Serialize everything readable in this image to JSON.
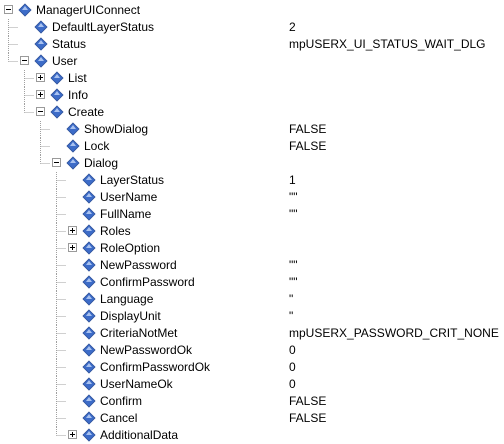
{
  "colors": {
    "diamond_fill": "#3d6cc8",
    "diamond_light": "#a9c2f0",
    "line": "#a0a0a0"
  },
  "icons": {
    "node": "diamond-icon",
    "expand": "plus-box-icon",
    "collapse": "minus-box-icon"
  },
  "tree": [
    {
      "name": "ManagerUIConnect",
      "value": "",
      "depth": 0,
      "state": "expanded"
    },
    {
      "name": "DefaultLayerStatus",
      "value": "2",
      "depth": 1,
      "state": "leaf"
    },
    {
      "name": "Status",
      "value": "mpUSERX_UI_STATUS_WAIT_DLG",
      "depth": 1,
      "state": "leaf"
    },
    {
      "name": "User",
      "value": "",
      "depth": 1,
      "state": "expanded"
    },
    {
      "name": "List",
      "value": "",
      "depth": 2,
      "state": "collapsed"
    },
    {
      "name": "Info",
      "value": "",
      "depth": 2,
      "state": "collapsed"
    },
    {
      "name": "Create",
      "value": "",
      "depth": 2,
      "state": "expanded"
    },
    {
      "name": "ShowDialog",
      "value": "FALSE",
      "depth": 3,
      "state": "leaf"
    },
    {
      "name": "Lock",
      "value": "FALSE",
      "depth": 3,
      "state": "leaf"
    },
    {
      "name": "Dialog",
      "value": "",
      "depth": 3,
      "state": "expanded"
    },
    {
      "name": "LayerStatus",
      "value": "1",
      "depth": 4,
      "state": "leaf"
    },
    {
      "name": "UserName",
      "value": "\"\"",
      "depth": 4,
      "state": "leaf"
    },
    {
      "name": "FullName",
      "value": "\"\"",
      "depth": 4,
      "state": "leaf"
    },
    {
      "name": "Roles",
      "value": "",
      "depth": 4,
      "state": "collapsed"
    },
    {
      "name": "RoleOption",
      "value": "",
      "depth": 4,
      "state": "collapsed"
    },
    {
      "name": "NewPassword",
      "value": "\"\"",
      "depth": 4,
      "state": "leaf"
    },
    {
      "name": "ConfirmPassword",
      "value": "\"\"",
      "depth": 4,
      "state": "leaf"
    },
    {
      "name": "Language",
      "value": "\"",
      "depth": 4,
      "state": "leaf"
    },
    {
      "name": "DisplayUnit",
      "value": "\"",
      "depth": 4,
      "state": "leaf"
    },
    {
      "name": "CriteriaNotMet",
      "value": "mpUSERX_PASSWORD_CRIT_NONE",
      "depth": 4,
      "state": "leaf"
    },
    {
      "name": "NewPasswordOk",
      "value": "0",
      "depth": 4,
      "state": "leaf"
    },
    {
      "name": "ConfirmPasswordOk",
      "value": "0",
      "depth": 4,
      "state": "leaf"
    },
    {
      "name": "UserNameOk",
      "value": "0",
      "depth": 4,
      "state": "leaf"
    },
    {
      "name": "Confirm",
      "value": "FALSE",
      "depth": 4,
      "state": "leaf"
    },
    {
      "name": "Cancel",
      "value": "FALSE",
      "depth": 4,
      "state": "leaf"
    },
    {
      "name": "AdditionalData",
      "value": "",
      "depth": 4,
      "state": "collapsed"
    }
  ]
}
